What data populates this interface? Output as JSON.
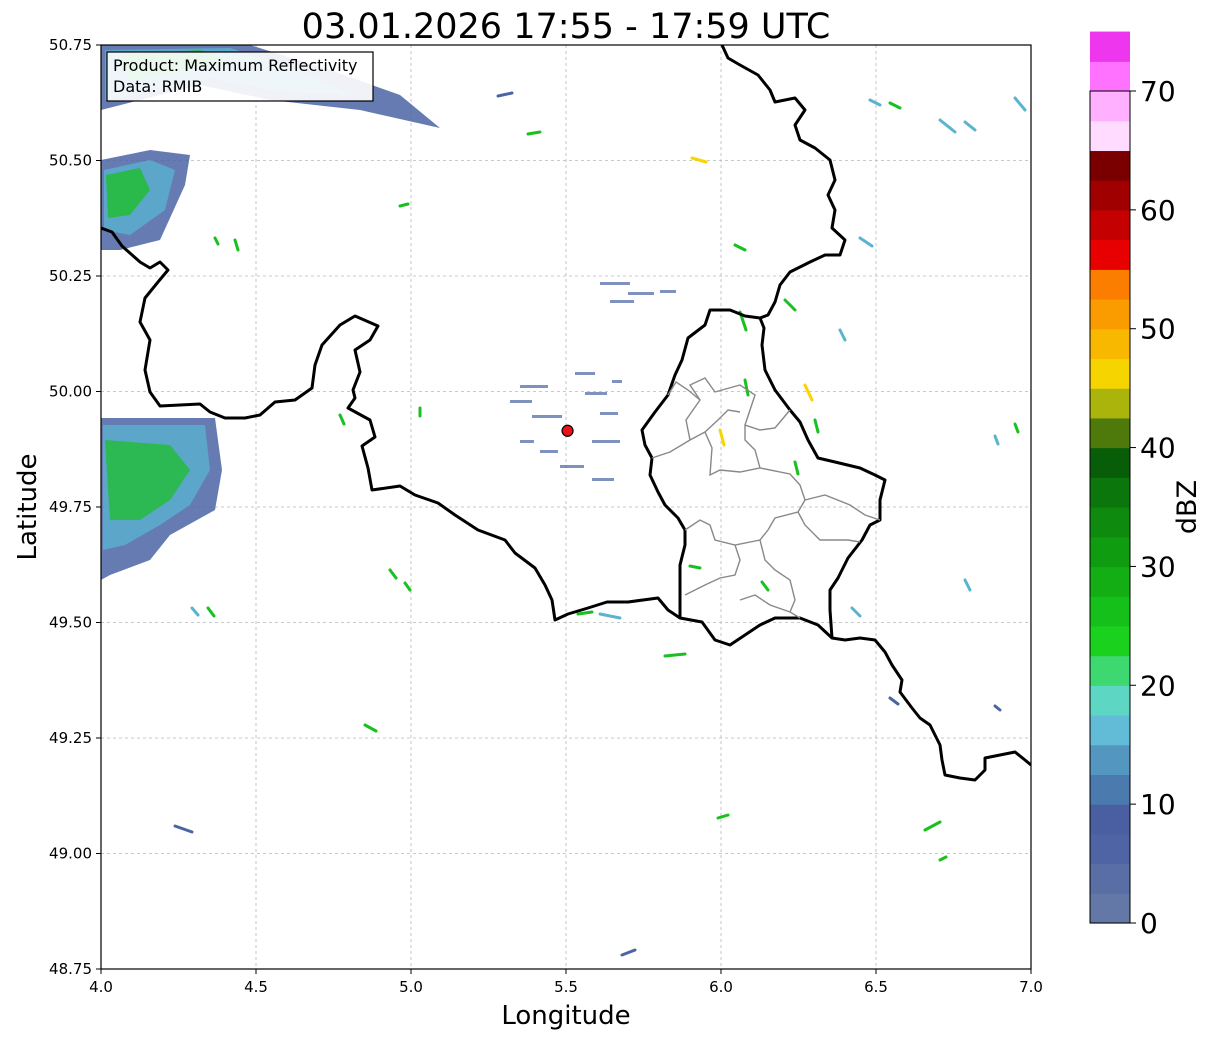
{
  "title": "03.01.2026 17:55 - 17:59 UTC",
  "info_box": {
    "product": "Product: Maximum Reflectivity",
    "data": "Data: RMIB"
  },
  "axes": {
    "xlabel": "Longitude",
    "ylabel": "Latitude",
    "xlim": [
      4.0,
      7.0
    ],
    "ylim": [
      48.75,
      50.75
    ],
    "xticks": [
      "4.0",
      "4.5",
      "5.0",
      "5.5",
      "6.0",
      "6.5",
      "7.0"
    ],
    "yticks": [
      "50.75",
      "50.50",
      "50.25",
      "50.00",
      "49.75",
      "49.50",
      "49.25",
      "49.00",
      "48.75"
    ],
    "grid": true
  },
  "radar_site": {
    "lon": 5.505,
    "lat": 49.915,
    "color": "#e8141a"
  },
  "colorbar": {
    "label": "dBZ",
    "ticks": [
      "0",
      "10",
      "20",
      "30",
      "40",
      "50",
      "60",
      "70"
    ],
    "range": [
      0,
      70
    ],
    "step": 2.5,
    "colors": [
      "#6478a8",
      "#5a6ea6",
      "#4e64a4",
      "#4a5fa2",
      "#4b7aae",
      "#5396c0",
      "#62bcd8",
      "#5dd6c4",
      "#3dd870",
      "#1ad21e",
      "#16c01a",
      "#12ae14",
      "#109c10",
      "#0e8a0e",
      "#0b760b",
      "#085e08",
      "#4e7a0c",
      "#aab40a",
      "#f6d400",
      "#f8b800",
      "#fa9c00",
      "#fb7e00",
      "#e80000",
      "#c40000",
      "#a00000",
      "#7a0000",
      "#ffdcff",
      "#ffb0ff",
      "#ff72ff",
      "#ee36ee"
    ]
  },
  "echo_palette": {
    "weak": "#4a64a4",
    "light": "#5ab4d0",
    "moderate": "#18c020",
    "strong": "#fad400"
  }
}
